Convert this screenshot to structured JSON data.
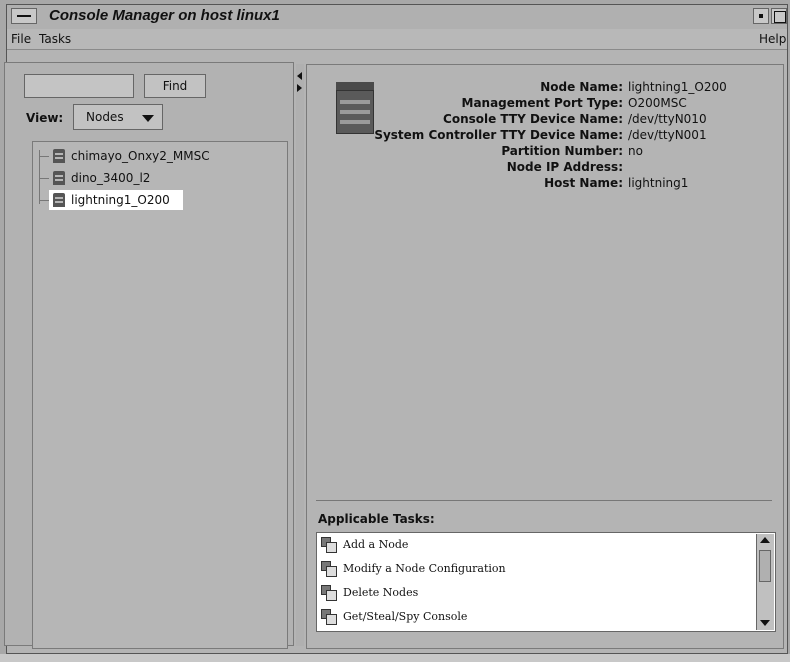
{
  "window": {
    "title": "Console Manager on host linux1"
  },
  "menubar": {
    "items": [
      "File",
      "Tasks"
    ],
    "help": "Help"
  },
  "left_panel": {
    "find_button": "Find",
    "find_input_value": "",
    "view_label": "View:",
    "view_selected": "Nodes",
    "nodes": [
      {
        "label": "chimayo_Onxy2_MMSC",
        "selected": false
      },
      {
        "label": "dino_3400_l2",
        "selected": false
      },
      {
        "label": "lightning1_O200",
        "selected": true
      }
    ]
  },
  "details": {
    "rows": [
      {
        "key": "Node Name:",
        "value": "lightning1_O200"
      },
      {
        "key": "Management Port Type:",
        "value": "O200MSC"
      },
      {
        "key": "Console TTY Device Name:",
        "value": "/dev/ttyN010"
      },
      {
        "key": "System Controller TTY Device Name:",
        "value": "/dev/ttyN001"
      },
      {
        "key": "Partition Number:",
        "value": "no"
      },
      {
        "key": "Node IP Address:",
        "value": ""
      },
      {
        "key": "Host Name:",
        "value": "lightning1"
      }
    ]
  },
  "tasks": {
    "label": "Applicable Tasks:",
    "items": [
      "Add a Node",
      "Modify a Node Configuration",
      "Delete Nodes",
      "Get/Steal/Spy Console"
    ]
  },
  "icons": {
    "window_menu": "window-menu-icon",
    "node": "server-icon",
    "task": "task-icon"
  }
}
